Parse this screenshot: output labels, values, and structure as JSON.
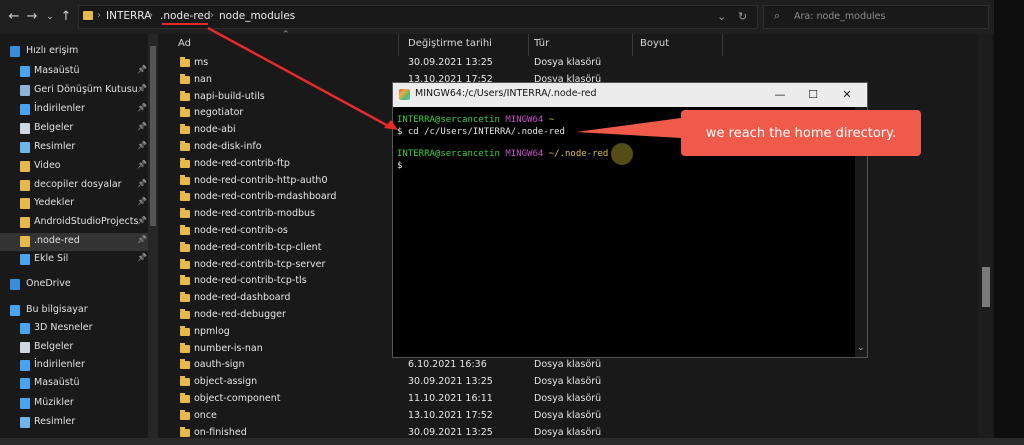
{
  "breadcrumb": [
    "INTERRA",
    ".node-red",
    "node_modules"
  ],
  "search": {
    "placeholder": "Ara: node_modules"
  },
  "sidebar": {
    "items": [
      {
        "label": "Hızlı erişim",
        "pinned": false,
        "icon": "star-icon",
        "color": "#3a8fdc"
      },
      {
        "label": "Masaüstü",
        "pinned": true,
        "icon": "desktop-icon",
        "color": "#4aa3f0"
      },
      {
        "label": "Geri Dönüşüm Kutusu",
        "pinned": true,
        "icon": "recycle-bin-icon",
        "color": "#8ab4d8"
      },
      {
        "label": "İndirilenler",
        "pinned": true,
        "icon": "download-icon",
        "color": "#4aa3f0"
      },
      {
        "label": "Belgeler",
        "pinned": true,
        "icon": "documents-icon",
        "color": "#cfd8e0"
      },
      {
        "label": "Resimler",
        "pinned": true,
        "icon": "pictures-icon",
        "color": "#6fb6e8"
      },
      {
        "label": "Video",
        "pinned": true,
        "icon": "folder-icon",
        "color": "#e7b84a"
      },
      {
        "label": "decopiler dosyalar",
        "pinned": true,
        "icon": "folder-icon",
        "color": "#e7b84a"
      },
      {
        "label": "Yedekler",
        "pinned": true,
        "icon": "folder-icon",
        "color": "#e7b84a"
      },
      {
        "label": "AndroidStudioProjects",
        "pinned": true,
        "icon": "folder-icon",
        "color": "#e7b84a"
      },
      {
        "label": ".node-red",
        "pinned": true,
        "icon": "folder-icon",
        "color": "#e7b84a"
      },
      {
        "label": "Ekle Sil",
        "pinned": true,
        "icon": "folder-icon",
        "color": "#4aa3f0"
      },
      {
        "label": "OneDrive",
        "pinned": false,
        "icon": "cloud-icon",
        "color": "#3a8fdc"
      },
      {
        "label": "Bu bilgisayar",
        "pinned": false,
        "icon": "computer-icon",
        "color": "#4aa3f0"
      },
      {
        "label": "3D Nesneler",
        "pinned": false,
        "icon": "cube-icon",
        "color": "#4aa3f0"
      },
      {
        "label": "Belgeler",
        "pinned": false,
        "icon": "documents-icon",
        "color": "#cfd8e0"
      },
      {
        "label": "İndirilenler",
        "pinned": false,
        "icon": "download-icon",
        "color": "#4aa3f0"
      },
      {
        "label": "Masaüstü",
        "pinned": false,
        "icon": "desktop-icon",
        "color": "#4aa3f0"
      },
      {
        "label": "Müzikler",
        "pinned": false,
        "icon": "music-icon",
        "color": "#4aa3f0"
      },
      {
        "label": "Resimler",
        "pinned": false,
        "icon": "pictures-icon",
        "color": "#6fb6e8"
      }
    ]
  },
  "columns": {
    "name": "Ad",
    "date": "Değiştirme tarihi",
    "type": "Tür",
    "size": "Boyut"
  },
  "files": [
    {
      "name": "ms",
      "date": "30.09.2021 13:25",
      "type": "Dosya klasörü"
    },
    {
      "name": "nan",
      "date": "13.10.2021 17:52",
      "type": "Dosya klasörü"
    },
    {
      "name": "napi-build-utils",
      "date": "",
      "type": ""
    },
    {
      "name": "negotiator",
      "date": "",
      "type": ""
    },
    {
      "name": "node-abi",
      "date": "",
      "type": ""
    },
    {
      "name": "node-disk-info",
      "date": "",
      "type": ""
    },
    {
      "name": "node-red-contrib-ftp",
      "date": "",
      "type": ""
    },
    {
      "name": "node-red-contrib-http-auth0",
      "date": "",
      "type": ""
    },
    {
      "name": "node-red-contrib-mdashboard",
      "date": "",
      "type": ""
    },
    {
      "name": "node-red-contrib-modbus",
      "date": "",
      "type": ""
    },
    {
      "name": "node-red-contrib-os",
      "date": "",
      "type": ""
    },
    {
      "name": "node-red-contrib-tcp-client",
      "date": "",
      "type": ""
    },
    {
      "name": "node-red-contrib-tcp-server",
      "date": "",
      "type": ""
    },
    {
      "name": "node-red-contrib-tcp-tls",
      "date": "",
      "type": ""
    },
    {
      "name": "node-red-dashboard",
      "date": "",
      "type": ""
    },
    {
      "name": "node-red-debugger",
      "date": "",
      "type": ""
    },
    {
      "name": "npmlog",
      "date": "",
      "type": ""
    },
    {
      "name": "number-is-nan",
      "date": "",
      "type": ""
    },
    {
      "name": "oauth-sign",
      "date": "6.10.2021 16:36",
      "type": "Dosya klasörü"
    },
    {
      "name": "object-assign",
      "date": "30.09.2021 13:25",
      "type": "Dosya klasörü"
    },
    {
      "name": "object-component",
      "date": "11.10.2021 16:11",
      "type": "Dosya klasörü"
    },
    {
      "name": "once",
      "date": "13.10.2021 17:52",
      "type": "Dosya klasörü"
    },
    {
      "name": "on-finished",
      "date": "30.09.2021 13:25",
      "type": "Dosya klasörü"
    }
  ],
  "terminal": {
    "title": "MINGW64:/c/Users/INTERRA/.node-red",
    "line1_user": "INTERRA@sercancetin",
    "line1_shell": "MINGW64",
    "line1_path": "~",
    "line2_cmd": "$ cd /c/Users/INTERRA/.node-red",
    "line3_user": "INTERRA@sercancetin",
    "line3_shell": "MINGW64",
    "line3_path": "~/.node-red",
    "line4_prompt": "$",
    "colors": {
      "user": "#3fcf3f",
      "shell": "#c74fc7",
      "path": "#d8c54a",
      "text": "#e6e6e6"
    }
  },
  "callout": {
    "text": "we reach the home directory.",
    "color": "#f05a4a"
  },
  "accent_arrow_color": "#e52a2a"
}
